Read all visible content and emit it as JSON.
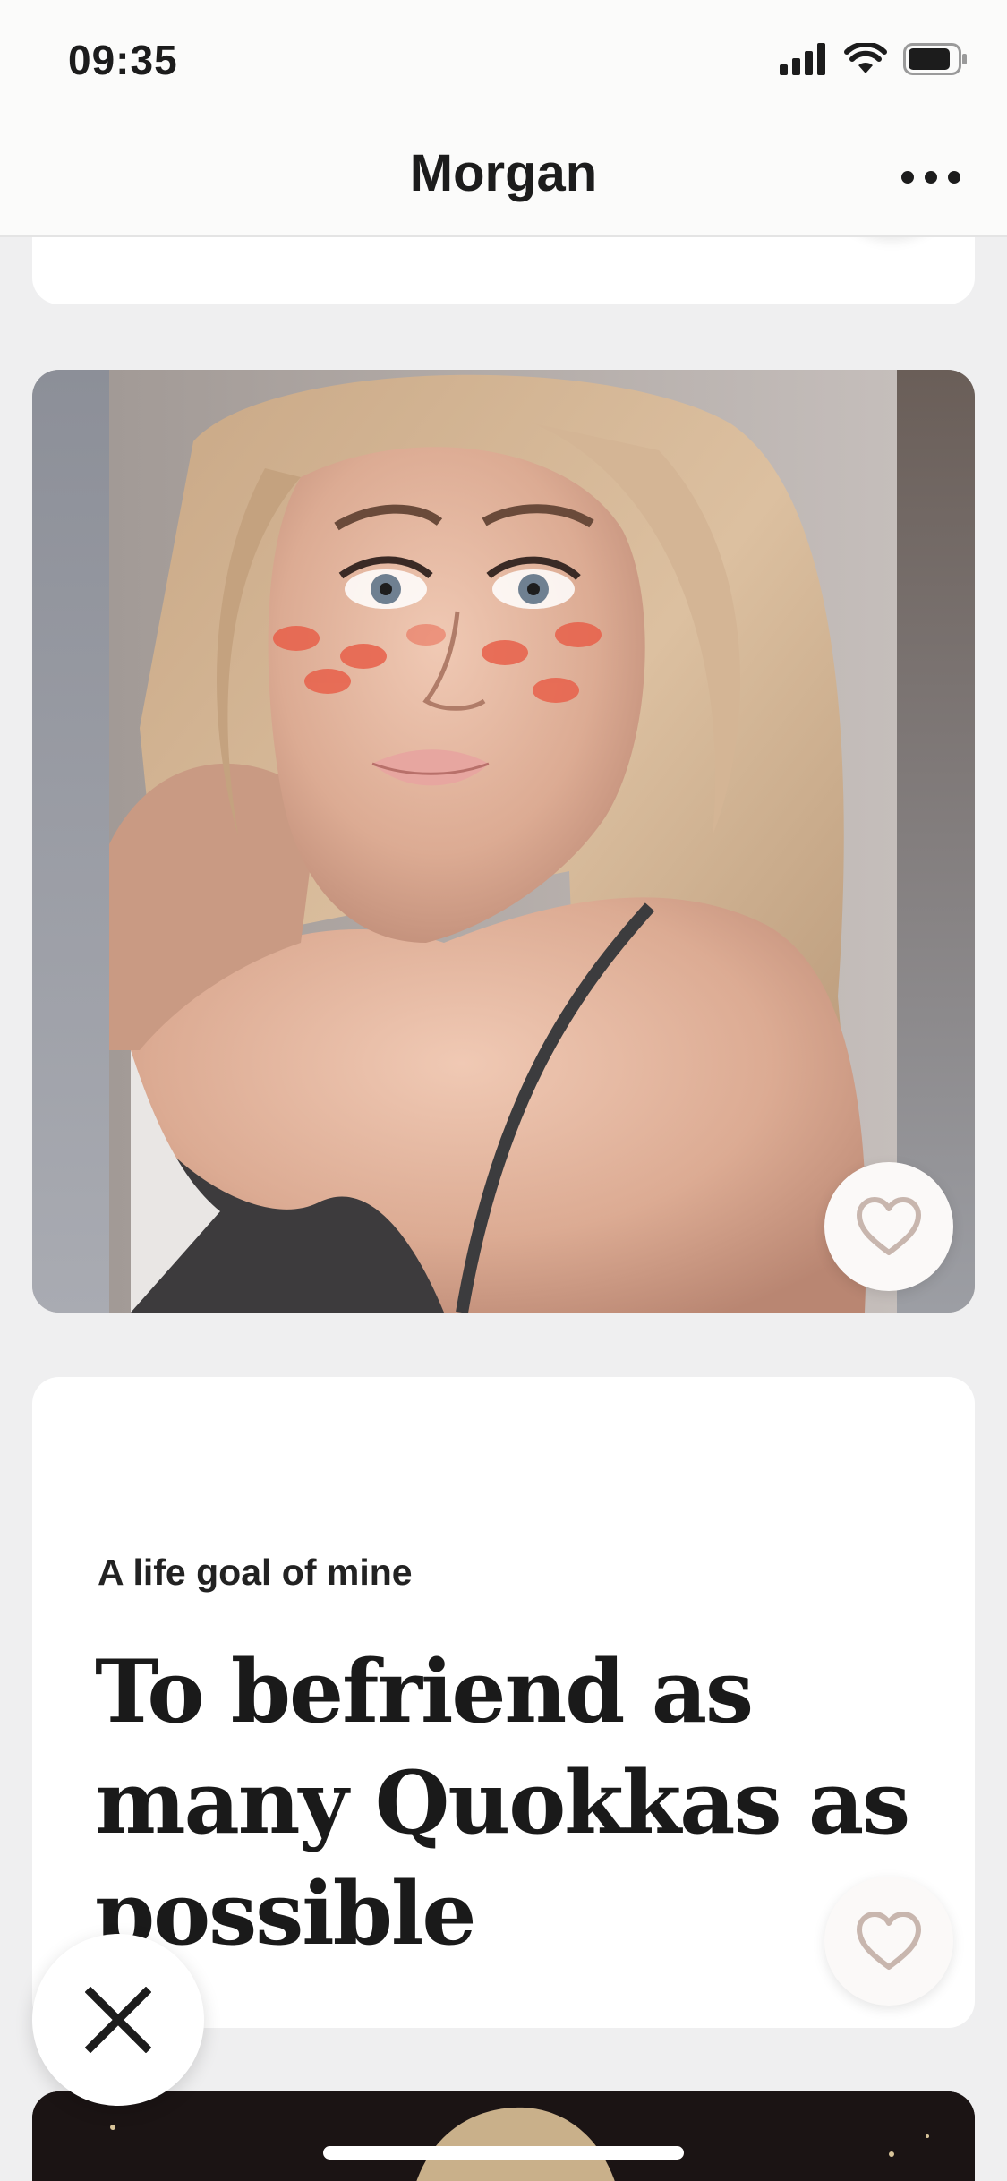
{
  "status_bar": {
    "time": "09:35",
    "icons": [
      "cellular-signal-icon",
      "wifi-icon",
      "battery-icon"
    ]
  },
  "header": {
    "title": "Morgan",
    "menu_icon": "more-horizontal-icon"
  },
  "photo_card": {
    "like_icon": "heart-outline-icon",
    "description": "profile photo"
  },
  "prompt_card": {
    "question": "A life goal of mine",
    "answer": "To befriend as many Quokkas as possible",
    "like_icon": "heart-outline-icon"
  },
  "actions": {
    "dismiss_icon": "close-x-icon"
  },
  "colors": {
    "background": "#efeff0",
    "card": "#ffffff",
    "header": "#fbfbfa",
    "heart_stroke": "#c8b6ae",
    "text": "#1c1c1c"
  }
}
